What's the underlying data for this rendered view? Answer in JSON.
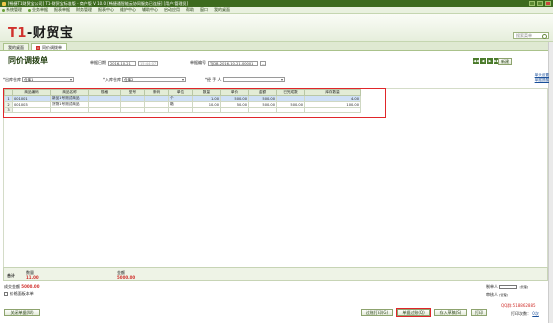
{
  "window": {
    "title": "[畅捷T1财贸宝公司] T1-财贸宝标准版 - 商户版 V 10.0 [畅捷通智能云协同服务已连接] [用户:管理员]"
  },
  "menu": [
    "系统管理",
    "业务单据",
    "报表单据",
    "财务管理",
    "报表中心",
    "维护中心",
    "辅助中心",
    "启动应用",
    "帮助",
    "窗口",
    "我的桌面"
  ],
  "brand": {
    "logo_prefix": "T1",
    "logo_rest": "-财贸宝",
    "search_placeholder": "搜索菜单"
  },
  "tabs": [
    {
      "label": "我的桌面",
      "active": false
    },
    {
      "label": "同价调拨单",
      "active": true
    }
  ],
  "doc": {
    "title": "同价调拨单",
    "date_label": "单据日期",
    "date_value": "2016-10-21",
    "time_value": "15:44:07",
    "number_label": "单据编号",
    "number_value": "TJDB-2016-10-21-00001",
    "new_button": "新建",
    "nav_buttons": [
      "◀◀",
      "◀",
      "▶",
      "▶▶"
    ],
    "help_links": [
      "单头设置",
      "单据提醒"
    ]
  },
  "filters": {
    "out_label": "*出库仓库",
    "out_value": "仓库1",
    "in_label": "*入库仓库",
    "in_value": "仓库2",
    "handler_label": "*经 手 人",
    "handler_value": ""
  },
  "grid": {
    "columns": [
      "",
      "商品编码",
      "商品名称",
      "规格",
      "型号",
      "条码",
      "单位",
      "数量",
      "单价",
      "金额",
      "已完成数",
      "库存数量"
    ],
    "rows": [
      [
        "1",
        "001001",
        "新品1号测试商品",
        "",
        "",
        "",
        "个",
        "1.00",
        "500.00",
        "500.00",
        "",
        "4.00"
      ],
      [
        "2",
        "001003",
        "货物1号测试商品",
        "",
        "",
        "",
        "箱",
        "10.00",
        "50.00",
        "500.00",
        "500.00",
        "100.00"
      ],
      [
        "3",
        "",
        "",
        "",
        "",
        "",
        "",
        "",
        "",
        "",
        "",
        ""
      ]
    ]
  },
  "totals": {
    "label": "合计",
    "qty_label": "数量",
    "qty_value": "11.00",
    "amount_label": "金额",
    "amount_value": "5000.00"
  },
  "footer": {
    "summary_label": "成交金额",
    "summary_value": "5000.00",
    "memo_checkbox": "价格面板本单",
    "maker_label": "制单人",
    "maker_value": "[管理]",
    "auditor_label": "审核人",
    "auditor_value": "[管理]",
    "collapse_button": "关闭单据(W)",
    "save_draft_button": "过账打印(G)",
    "post_button": "单据过账(Q)",
    "save_button": "存入草稿(S)",
    "print_button": "打印",
    "qq_text": "QQ群:518862885",
    "print_count_label": "打印次数：",
    "print_count_value": "0次"
  }
}
